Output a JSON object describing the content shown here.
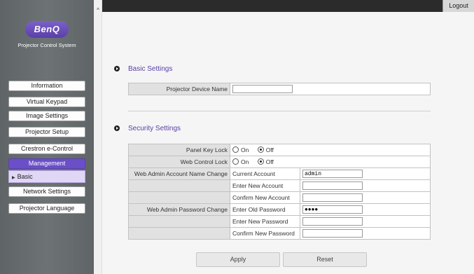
{
  "brand": {
    "logo_text": "BenQ",
    "system_title": "Projector Control System"
  },
  "topbar": {
    "logout_label": "Logout",
    "scroll_up_glyph": "^"
  },
  "nav": {
    "items": [
      {
        "label": "Information"
      },
      {
        "label": "Virtual Keypad"
      },
      {
        "label": "Image Settings"
      },
      {
        "label": "Projector Setup"
      },
      {
        "label": "Crestron e-Control"
      },
      {
        "label": "Management"
      },
      {
        "label": "Network Settings"
      },
      {
        "label": "Projector Language"
      }
    ],
    "sub_item": {
      "label": "Basic"
    }
  },
  "basic": {
    "title": "Basic Settings",
    "device_name_label": "Projector Device Name",
    "device_name_value": ""
  },
  "security": {
    "title": "Security Settings",
    "panel_key_lock_label": "Panel Key Lock",
    "web_control_lock_label": "Web Control Lock",
    "on_label": "On",
    "off_label": "Off",
    "panel_key_lock_value": "Off",
    "web_control_lock_value": "Off",
    "account_change_label": "Web Admin Account Name Change",
    "current_account_label": "Current Account",
    "current_account_value": "admin",
    "new_account_label": "Enter New Account",
    "confirm_account_label": "Confirm New Account",
    "password_change_label": "Web Admin Password Change",
    "old_password_label": "Enter Old Password",
    "old_password_value": "●●●●",
    "new_password_label": "Enter New Password",
    "confirm_password_label": "Confirm New Password"
  },
  "actions": {
    "apply_label": "Apply",
    "reset_label": "Reset"
  }
}
